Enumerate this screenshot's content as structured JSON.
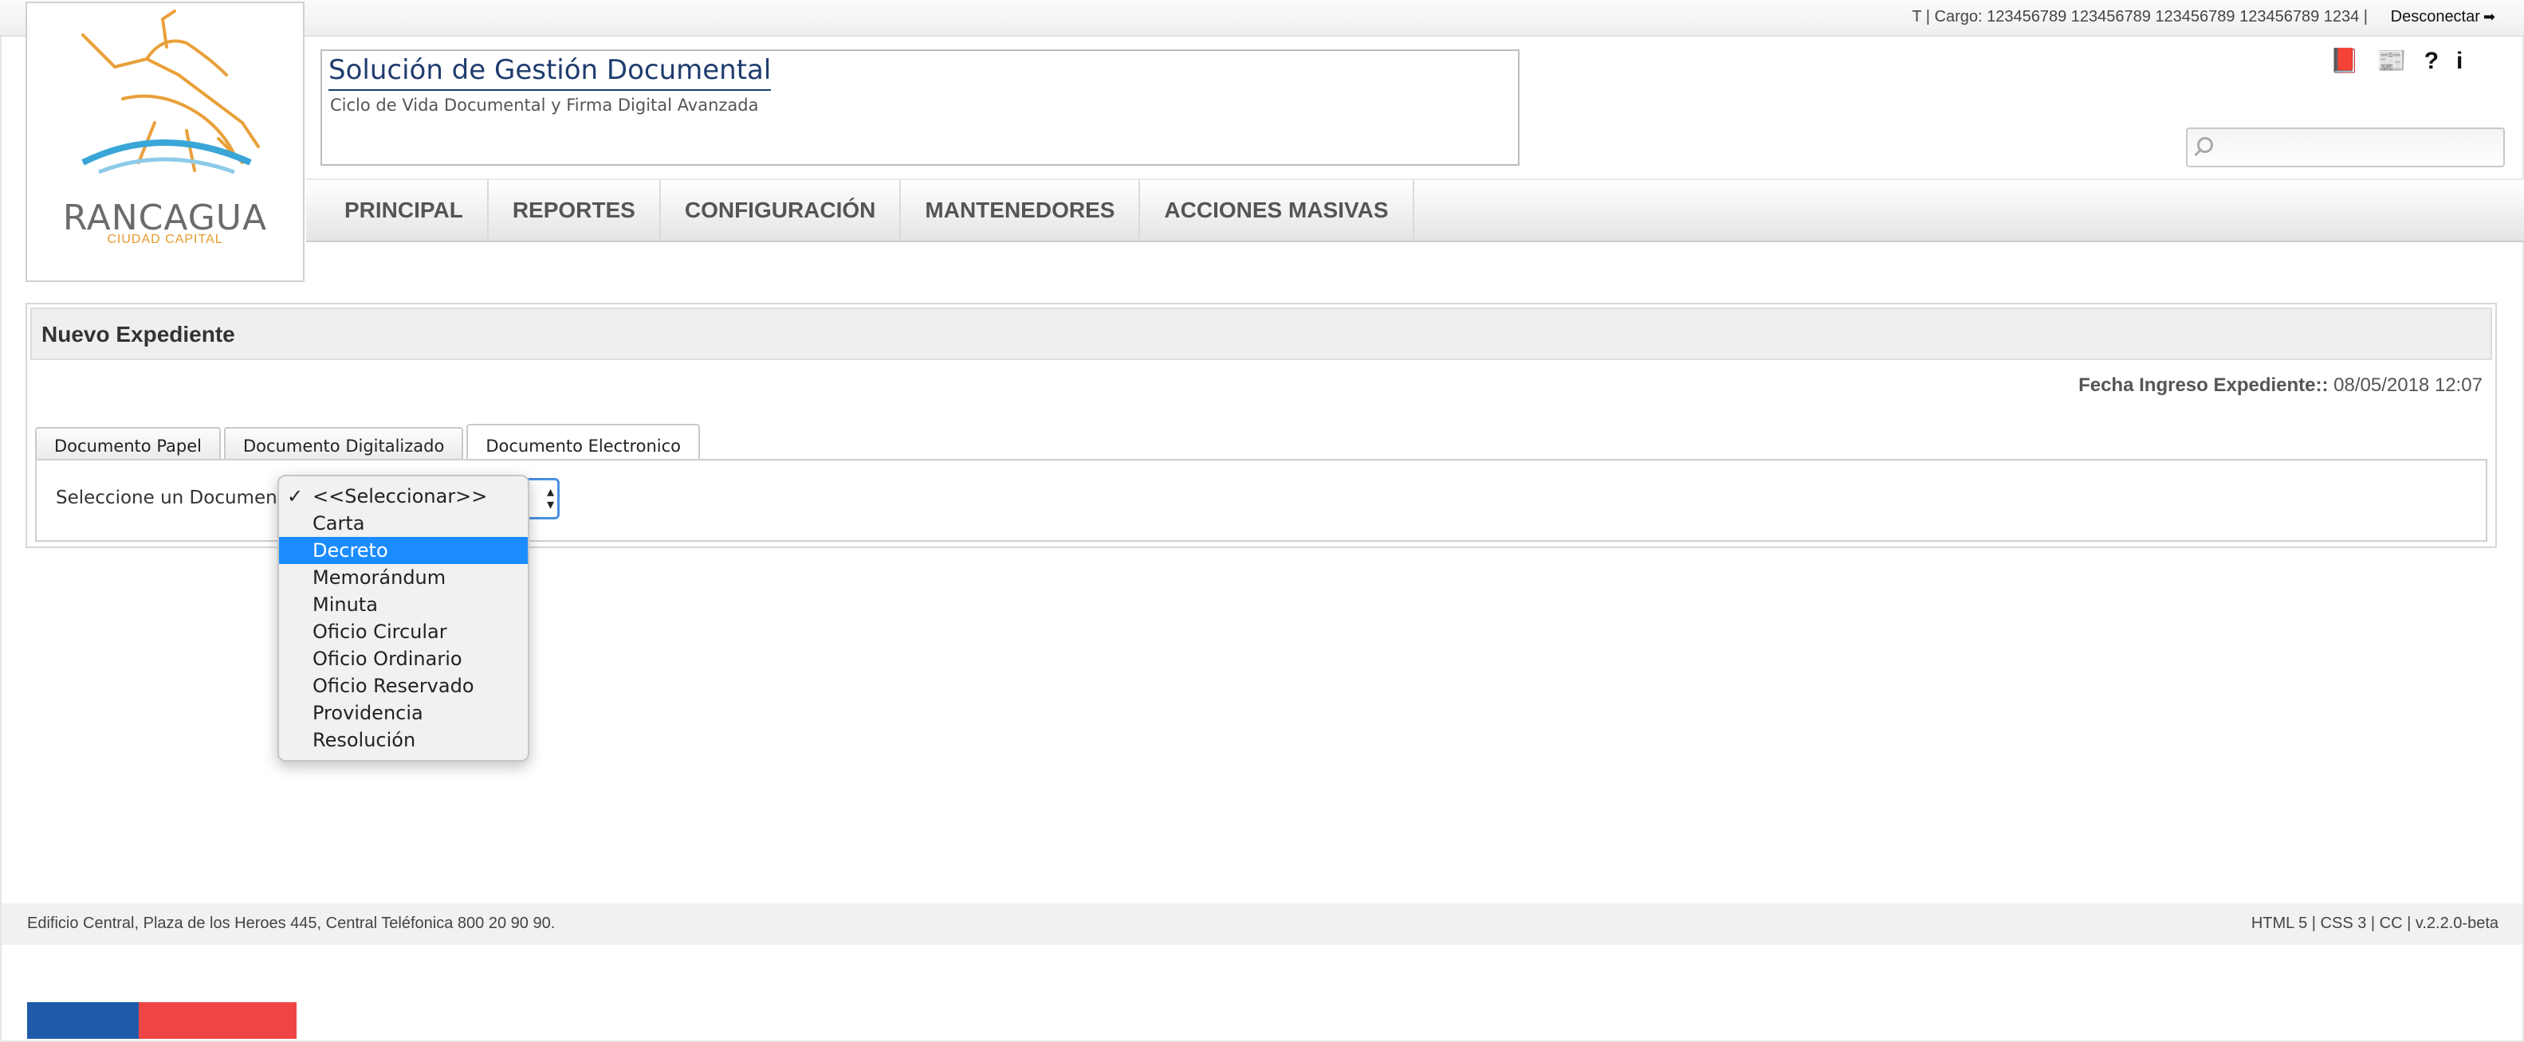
{
  "topbar": {
    "user_info": "T | Cargo: 123456789 123456789 123456789 123456789 1234 |",
    "logout_label": "Desconectar"
  },
  "logo": {
    "name": "RANCAGUA",
    "tagline": "CIUDAD CAPITAL"
  },
  "header": {
    "title": "Solución de Gestión Documental",
    "subtitle": "Ciclo de Vida Documental y Firma Digital Avanzada",
    "icons": [
      "book-icon",
      "newspaper-icon",
      "help-icon",
      "info-icon"
    ],
    "search": {
      "placeholder": "",
      "value": ""
    }
  },
  "nav": {
    "items": [
      {
        "label": "PRINCIPAL"
      },
      {
        "label": "REPORTES"
      },
      {
        "label": "CONFIGURACIÓN"
      },
      {
        "label": "MANTENEDORES"
      },
      {
        "label": "ACCIONES MASIVAS"
      }
    ]
  },
  "panel": {
    "title": "Nuevo Expediente",
    "fecha_label": "Fecha Ingreso Expediente::",
    "fecha_value": "08/05/2018 12:07",
    "tabs": [
      {
        "label": "Documento Papel"
      },
      {
        "label": "Documento Digitalizado"
      },
      {
        "label": "Documento Electronico",
        "active": true
      }
    ],
    "select_label": "Seleccione un Documento",
    "select": {
      "selected": "<<Seleccionar>>",
      "highlighted": "Decreto",
      "options": [
        "<<Seleccionar>>",
        "Carta",
        "Decreto",
        "Memorándum",
        "Minuta",
        "Oficio Circular",
        "Oficio Ordinario",
        "Oficio Reservado",
        "Providencia",
        "Resolución"
      ]
    }
  },
  "footer": {
    "address": "Edificio Central, Plaza de los Heroes 445, Central Teléfonica 800 20 90 90.",
    "meta": "HTML 5 | CSS 3 | CC | v.2.2.0-beta"
  },
  "colors": {
    "accent": "#1a8cff",
    "title_blue": "#1f3c6e",
    "flag_blue": "#1e5aa8",
    "flag_red": "#ef4444",
    "logo_orange": "#e79a2b"
  }
}
